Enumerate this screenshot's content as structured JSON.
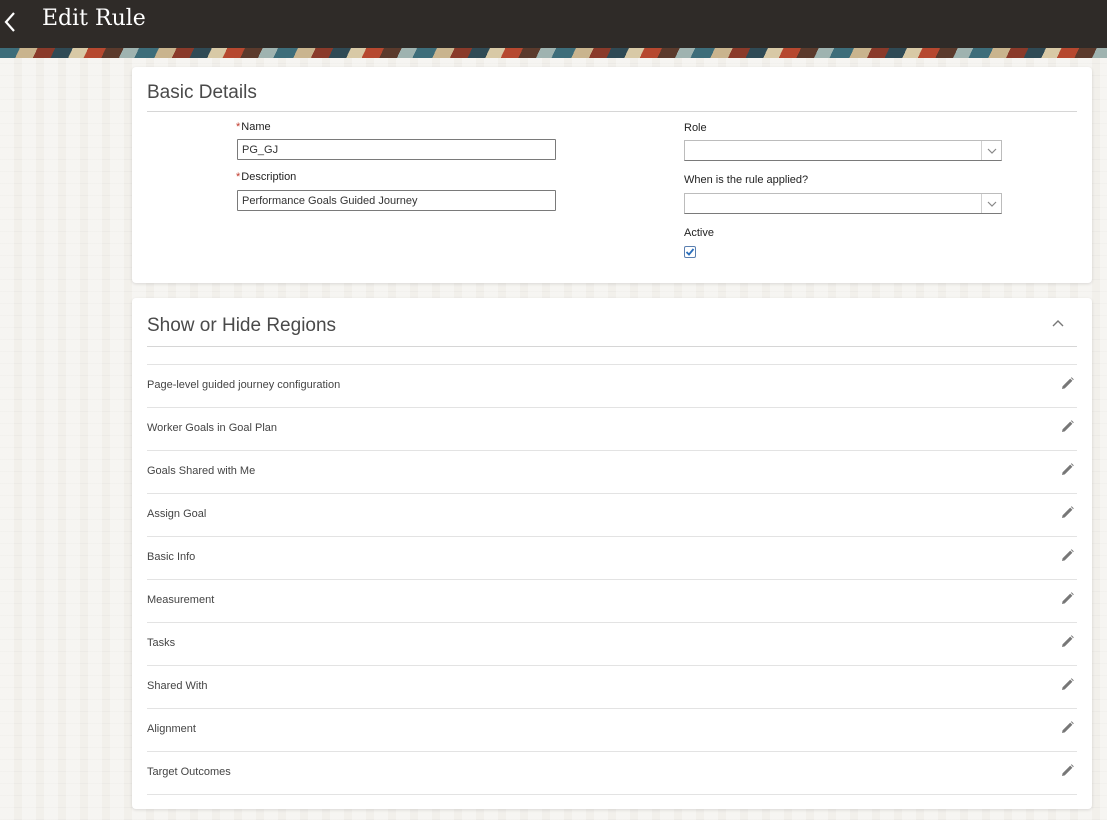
{
  "header": {
    "title": "Edit Rule",
    "back_icon": "chevron-left-icon"
  },
  "basic_details": {
    "title": "Basic Details",
    "name": {
      "label": "Name",
      "required_marker": "*",
      "value": "PG_GJ"
    },
    "description": {
      "label": "Description",
      "required_marker": "*",
      "value": "Performance Goals Guided Journey"
    },
    "role": {
      "label": "Role",
      "value": ""
    },
    "when_applied": {
      "label": "When is the rule applied?",
      "value": ""
    },
    "active": {
      "label": "Active",
      "checked": true
    }
  },
  "regions": {
    "title": "Show or Hide Regions",
    "collapse_icon": "chevron-up-icon",
    "edit_icon": "pencil-icon",
    "items": [
      {
        "label": "Page-level guided journey configuration"
      },
      {
        "label": "Worker Goals in Goal Plan"
      },
      {
        "label": "Goals Shared with Me"
      },
      {
        "label": "Assign Goal"
      },
      {
        "label": "Basic Info"
      },
      {
        "label": "Measurement"
      },
      {
        "label": "Tasks"
      },
      {
        "label": "Shared With"
      },
      {
        "label": "Alignment"
      },
      {
        "label": "Target Outcomes"
      }
    ]
  },
  "colors": {
    "header_bg": "#2f2b28",
    "checkbox_accent": "#2a6ebb"
  }
}
